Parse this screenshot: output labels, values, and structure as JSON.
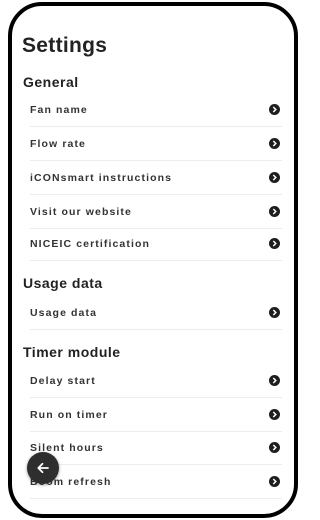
{
  "page": {
    "title": "Settings"
  },
  "sections": [
    {
      "title": "General",
      "items": [
        {
          "label": "Fan name"
        },
        {
          "label": "Flow rate"
        },
        {
          "label": "iCONsmart instructions"
        },
        {
          "label": "Visit our website"
        },
        {
          "label": "NICEIC certification"
        }
      ]
    },
    {
      "title": "Usage data",
      "items": [
        {
          "label": "Usage data"
        }
      ]
    },
    {
      "title": "Timer module",
      "items": [
        {
          "label": "Delay start"
        },
        {
          "label": "Run on timer"
        },
        {
          "label": "Silent hours"
        },
        {
          "label": "Boom refresh"
        }
      ]
    }
  ],
  "icons": {
    "row_chevron": "chevron-right-circle-icon",
    "back": "arrow-left-icon"
  },
  "colors": {
    "chevron": "#1e1e1e",
    "back_button": "#2e2e2e",
    "divider": "#ececec"
  }
}
